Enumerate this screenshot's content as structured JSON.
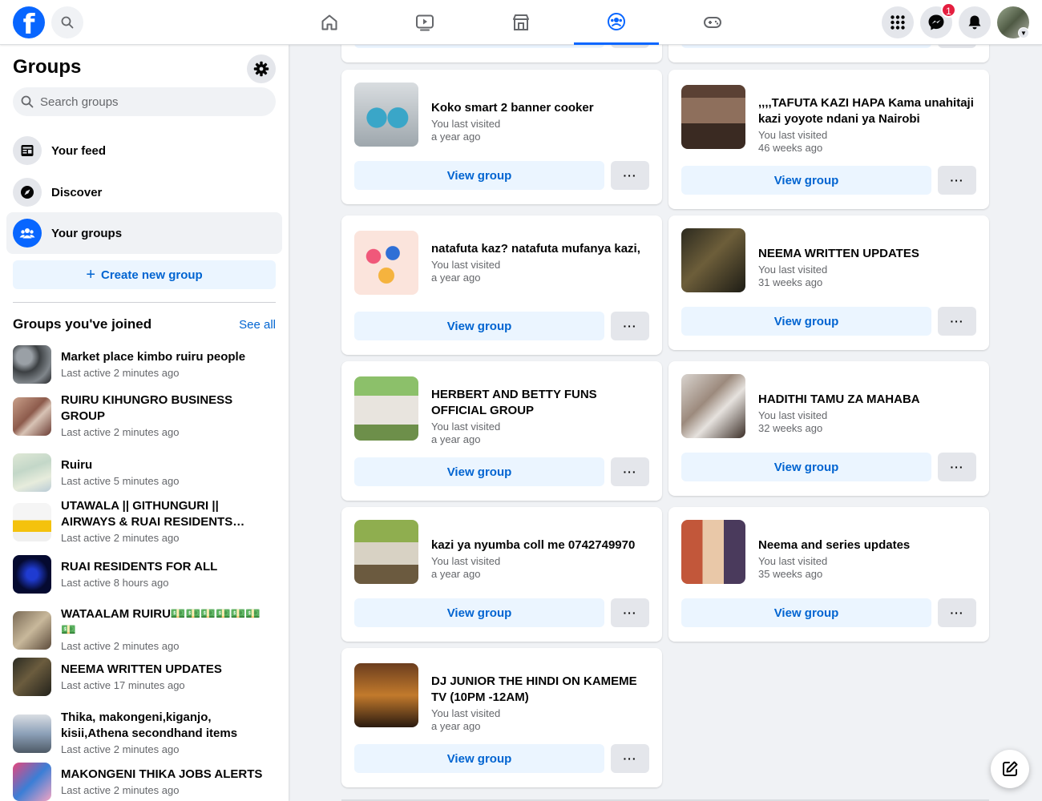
{
  "topbar": {
    "logo_letter": "f",
    "messenger_badge": "1"
  },
  "sidebar": {
    "title": "Groups",
    "search_placeholder": "Search groups",
    "nav": [
      {
        "label": "Your feed"
      },
      {
        "label": "Discover"
      },
      {
        "label": "Your groups"
      }
    ],
    "create_label": "Create new group",
    "create_icon": "+",
    "joined_title": "Groups you've joined",
    "see_all": "See all",
    "joined": [
      {
        "name": "Market place kimbo ruiru people",
        "meta": "Last active 2 minutes ago"
      },
      {
        "name": "RUIRU KIHUNGRO BUSINESS GROUP",
        "meta": "Last active 2 minutes ago"
      },
      {
        "name": "Ruiru",
        "meta": "Last active 5 minutes ago"
      },
      {
        "name": "UTAWALA || GITHUNGURI || AIRWAYS & RUAI RESIDENTS FORUM",
        "meta": "Last active 2 minutes ago"
      },
      {
        "name": "RUAI RESIDENTS FOR ALL",
        "meta": "Last active 8 hours ago"
      },
      {
        "name": "WATAALAM RUIRU💵💵💵💵💵💵💵",
        "meta": "Last active 2 minutes ago"
      },
      {
        "name": "NEEMA WRITTEN UPDATES",
        "meta": "Last active 17 minutes ago"
      },
      {
        "name": "Thika, makongeni,kiganjo, kisii,Athena secondhand items",
        "meta": "Last active 2 minutes ago"
      },
      {
        "name": "MAKONGENI THIKA JOBS ALERTS",
        "meta": "Last active 2 minutes ago"
      }
    ]
  },
  "main": {
    "view_label": "View group",
    "more_label": "···",
    "cards": [
      {
        "name": "Koko smart 2 banner cooker",
        "visited": "You last visited",
        "when": "a year ago"
      },
      {
        "name": ",,,,TAFUTA KAZI HAPA Kama unahitaji kazi yoyote ndani ya Nairobi",
        "visited": "You last visited",
        "when": "46 weeks ago"
      },
      {
        "name": "natafuta kaz? natafuta mufanya kazi,",
        "visited": "You last visited",
        "when": "a year ago"
      },
      {
        "name": "NEEMA WRITTEN UPDATES",
        "visited": "You last visited",
        "when": "31 weeks ago"
      },
      {
        "name": "HERBERT AND BETTY FUNS OFFICIAL GROUP",
        "visited": "You last visited",
        "when": "a year ago"
      },
      {
        "name": "HADITHI TAMU ZA MAHABA",
        "visited": "You last visited",
        "when": "32 weeks ago"
      },
      {
        "name": "kazi ya nyumba coll me 0742749970",
        "visited": "You last visited",
        "when": "a year ago"
      },
      {
        "name": "Neema and series updates",
        "visited": "You last visited",
        "when": "35 weeks ago"
      },
      {
        "name": "DJ JUNIOR THE HINDI ON KAMEME TV (10PM -12AM)",
        "visited": "You last visited",
        "when": "a year ago"
      }
    ]
  },
  "colors": {
    "brand": "#0866ff",
    "link": "#0064d1",
    "badge": "#e41e3f"
  }
}
